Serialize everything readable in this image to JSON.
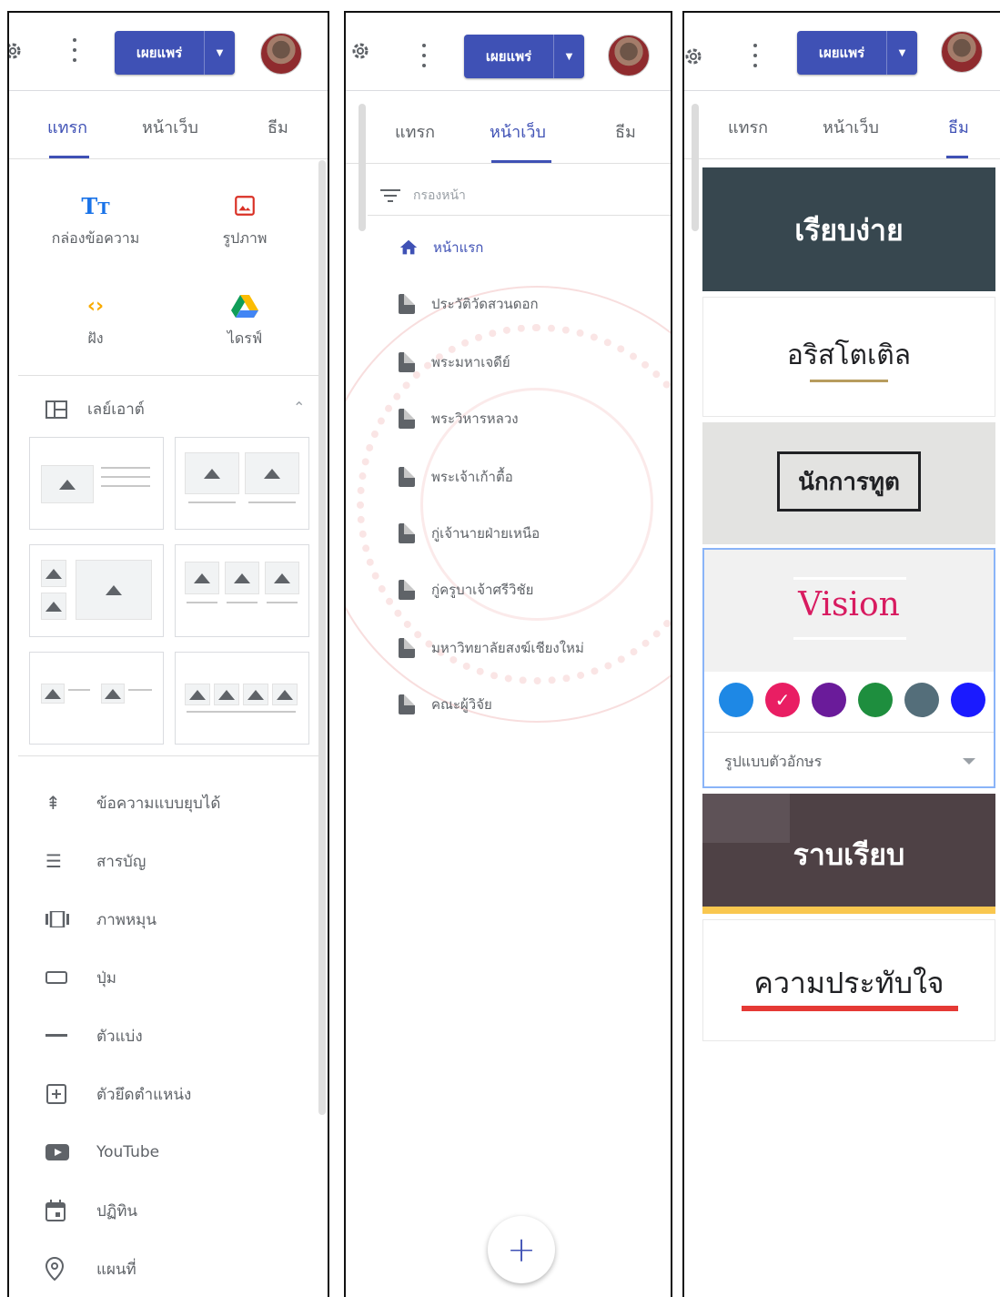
{
  "toolbar": {
    "publish_label": "เผยแพร่",
    "settings_icon": "gear-icon",
    "more_icon": "more-vert-icon",
    "dropdown_icon": "caret-down-icon",
    "publish_color": "#3f51b5"
  },
  "tabs": [
    "แทรก",
    "หน้าเว็บ",
    "ธีม"
  ],
  "insert": {
    "items": [
      {
        "label": "กล่องข้อความ",
        "icon": "text-box-icon"
      },
      {
        "label": "รูปภาพ",
        "icon": "image-icon"
      },
      {
        "label": "ฝัง",
        "icon": "embed-icon"
      },
      {
        "label": "ไดรฟ์",
        "icon": "drive-icon"
      }
    ],
    "layouts_label": "เลย์เอาต์",
    "components": [
      {
        "label": "ข้อความแบบยุบได้",
        "icon": "collapsible-text-icon"
      },
      {
        "label": "สารบัญ",
        "icon": "table-of-contents-icon"
      },
      {
        "label": "ภาพหมุน",
        "icon": "carousel-icon"
      },
      {
        "label": "ปุ่ม",
        "icon": "button-icon"
      },
      {
        "label": "ตัวแบ่ง",
        "icon": "divider-icon"
      },
      {
        "label": "ตัวยึดตำแหน่ง",
        "icon": "placeholder-icon"
      },
      {
        "label": "YouTube",
        "icon": "youtube-icon"
      },
      {
        "label": "ปฏิทิน",
        "icon": "calendar-icon"
      },
      {
        "label": "แผนที่",
        "icon": "map-icon"
      }
    ]
  },
  "pages": {
    "filter_placeholder": "กรองหน้า",
    "items": [
      {
        "label": "หน้าแรก",
        "home": true
      },
      {
        "label": "ประวัติวัดสวนดอก"
      },
      {
        "label": "พระมหาเจดีย์"
      },
      {
        "label": "พระวิหารหลวง"
      },
      {
        "label": "พระเจ้าเก้าตื้อ"
      },
      {
        "label": "กู่เจ้านายฝ่ายเหนือ"
      },
      {
        "label": "กู่ครูบาเจ้าศรีวิชัย"
      },
      {
        "label": "มหาวิทยาลัยสงฆ์เชียงใหม่"
      },
      {
        "label": "คณะผู้วิจัย"
      }
    ],
    "add_label": "+"
  },
  "themes": {
    "items": [
      "เรียบง่าย",
      "อริสโตเติล",
      "นักการทูต",
      "Vision",
      "ราบเรียบ",
      "ความประทับใจ"
    ],
    "font_style_label": "รูปแบบตัวอักษร",
    "swatch_colors": [
      "#1e88e5",
      "#e91e63",
      "#6a1b9a",
      "#1e8e3e",
      "#546e7a",
      "#1a1aff"
    ],
    "selected_swatch": 1
  }
}
